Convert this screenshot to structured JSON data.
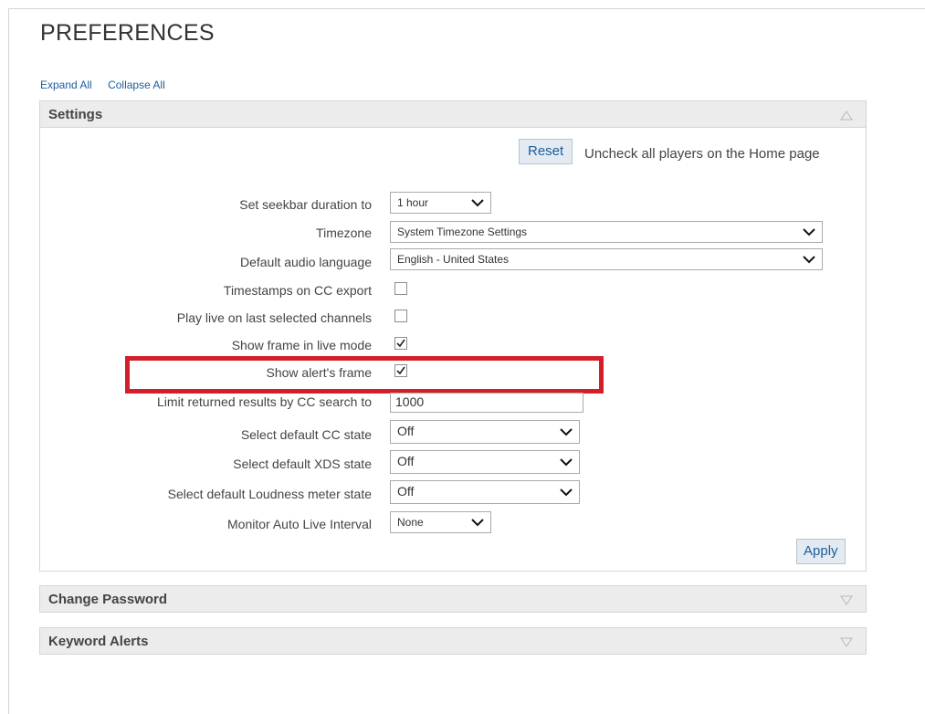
{
  "page": {
    "title": "PREFERENCES"
  },
  "links": {
    "expand_all": "Expand All",
    "collapse_all": "Collapse All"
  },
  "panels": {
    "settings": "Settings",
    "change_password": "Change Password",
    "keyword_alerts": "Keyword Alerts"
  },
  "reset": {
    "label": "Reset",
    "description": "Uncheck all players on the Home page"
  },
  "fields": {
    "seekbar": {
      "label": "Set seekbar duration to",
      "value": "1 hour"
    },
    "timezone": {
      "label": "Timezone",
      "value": "System Timezone Settings"
    },
    "audio_language": {
      "label": "Default audio language",
      "value": "English - United States"
    },
    "timestamps_cc": {
      "label": "Timestamps on CC export",
      "checked": false
    },
    "play_live": {
      "label": "Play live on last selected channels",
      "checked": false
    },
    "show_frame_live": {
      "label": "Show frame in live mode",
      "checked": true
    },
    "show_alert_frame": {
      "label": "Show alert's frame",
      "checked": true
    },
    "limit_results": {
      "label": "Limit returned results by CC search to",
      "value": "1000"
    },
    "cc_state": {
      "label": "Select default CC state",
      "value": "Off"
    },
    "xds_state": {
      "label": "Select default XDS state",
      "value": "Off"
    },
    "loudness_state": {
      "label": "Select default Loudness meter state",
      "value": "Off"
    },
    "auto_live": {
      "label": "Monitor Auto Live Interval",
      "value": "None"
    }
  },
  "apply": {
    "label": "Apply"
  },
  "colors": {
    "link": "#1b5e9b",
    "highlight": "#d21f2a",
    "panel_header": "#ececec"
  },
  "icons": {
    "collapse": "triangle-up-icon",
    "expand": "triangle-down-icon",
    "dropdown": "chevron-down-icon",
    "check": "checkmark-icon"
  }
}
